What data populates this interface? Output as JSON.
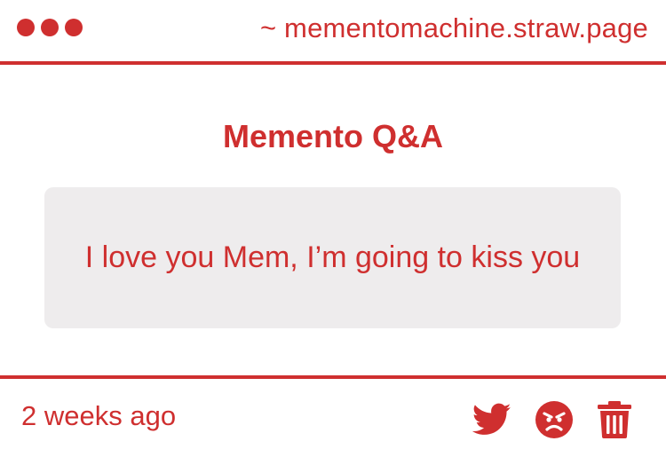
{
  "header": {
    "url": "~ mementomachine.straw.page",
    "dots": [
      "dot",
      "dot",
      "dot"
    ]
  },
  "main": {
    "title": "Memento Q&A",
    "message": "I love you Mem, I’m going to kiss you"
  },
  "footer": {
    "timestamp": "2 weeks ago",
    "actions": [
      "twitter-icon",
      "angry-face-icon",
      "trash-icon"
    ]
  },
  "colors": {
    "accent": "#cf2f2f",
    "card_background": "#eeeced",
    "background": "#ffffff"
  }
}
